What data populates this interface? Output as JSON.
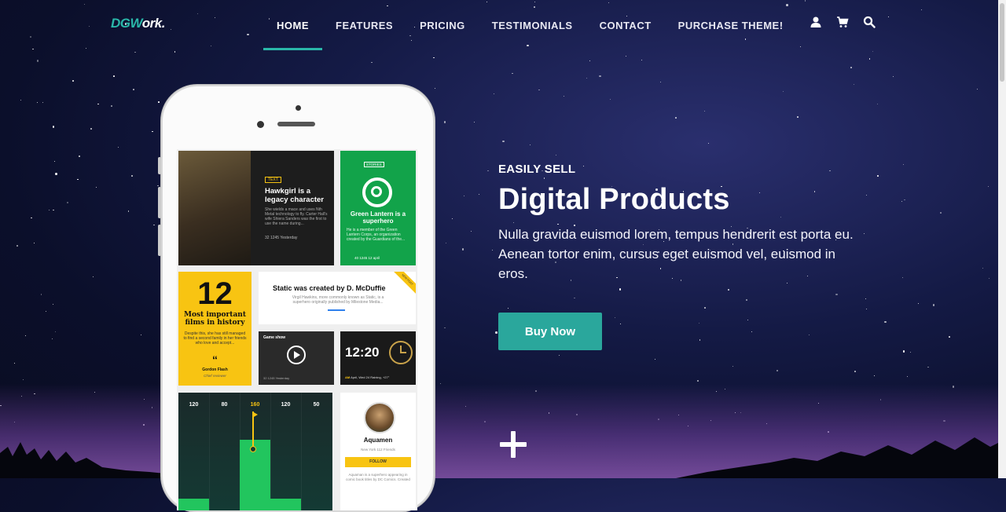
{
  "brand": {
    "logo_part1": "DGW",
    "logo_part2": "ork."
  },
  "nav": {
    "items": [
      {
        "label": "HOME",
        "active": true
      },
      {
        "label": "FEATURES",
        "active": false
      },
      {
        "label": "PRICING",
        "active": false
      },
      {
        "label": "TESTIMONIALS",
        "active": false
      },
      {
        "label": "CONTACT",
        "active": false
      },
      {
        "label": "PURCHASE THEME!",
        "active": false
      }
    ],
    "icons": [
      "user-icon",
      "cart-icon",
      "search-icon"
    ]
  },
  "hero": {
    "kicker": "EASILY SELL",
    "headline": "Digital Products",
    "description": "Nulla gravida euismod lorem, tempus hendrerit est porta eu. Aenean tortor enim, cursus eget euismod vel, euismod in eros.",
    "button_label": "Buy Now"
  },
  "phone_screen": {
    "hawkgirl": {
      "tag": "TEXT",
      "title": "Hawkgirl is a legacy character",
      "text": "She wields a mace and uses Nth Metal technology to fly. Carter Hall's wife Shiera Sanders was the first to use the name during...",
      "meta": "32   1245   Yesterday"
    },
    "green_lantern": {
      "tag": "STORIES",
      "title": "Green Lantern is a superhero",
      "text": "He is a member of the Green Lantern Corps, an organization created by the Guardians of the...",
      "meta": "40   1245   12 april"
    },
    "films": {
      "number": "12",
      "title": "Most important films in history",
      "text": "Despite this, she has still managed to find a second family in her friends who love and accept...",
      "quote_mark": "“",
      "author": "Gordon Flash",
      "role": "Chief reviewer"
    },
    "static_card": {
      "title": "Static was created by D. McDuffie",
      "text": "Virgil Hawkins, more commonly known as Static, is a superhero originally published by Milestone Media...",
      "ribbon": "NEW POST"
    },
    "game": {
      "label": "Game show",
      "meta": "32   1245   Yesterday"
    },
    "clock": {
      "time": "12:20",
      "meta_am": "AM",
      "meta_date": "April, Wed 24",
      "meta_weather": "Raining, +27°"
    },
    "bars": {
      "values": [
        "120",
        "80",
        "160",
        "120",
        "50"
      ],
      "highlight_index": 2,
      "fill_levels": [
        0.1,
        0,
        0.6,
        0.1,
        0
      ]
    },
    "profile": {
      "name": "Aquamen",
      "meta": "New York   112 Friends",
      "follow_label": "FOLLOW",
      "text": "Aquaman is a superhero appearing in comic book titles by DC Comics. Created"
    }
  },
  "colors": {
    "accent": "#2ab7a9",
    "button": "#2aa79c",
    "yellow": "#f8c412",
    "green": "#12a34a"
  }
}
